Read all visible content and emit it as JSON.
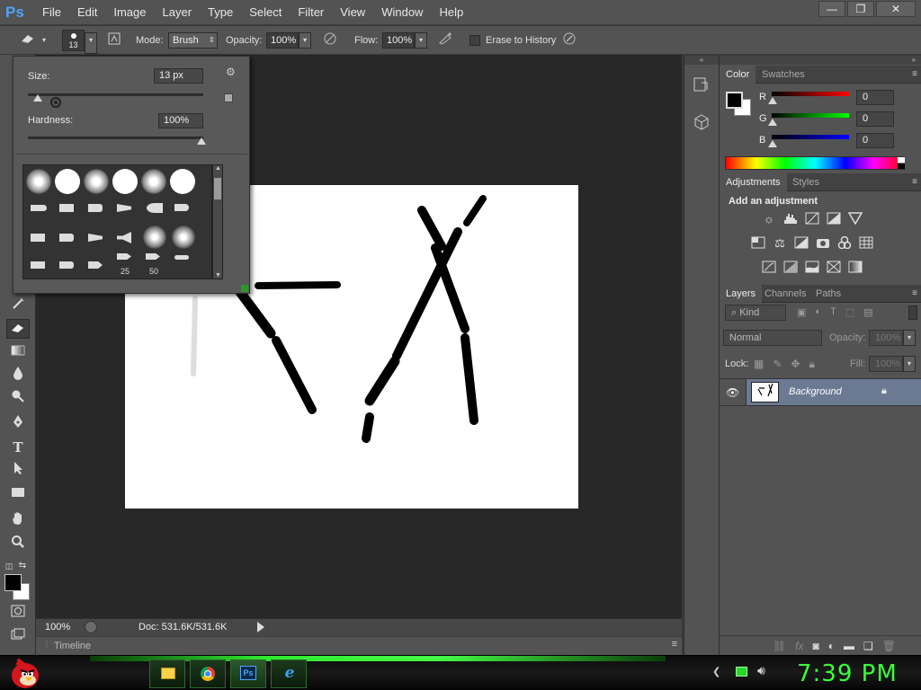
{
  "app": {
    "logo": "Ps",
    "menus": [
      "File",
      "Edit",
      "Image",
      "Layer",
      "Type",
      "Select",
      "Filter",
      "View",
      "Window",
      "Help"
    ]
  },
  "window_controls": {
    "minimize": "—",
    "restore": "❐",
    "close": "✕"
  },
  "options_bar": {
    "brush_size": "13",
    "mode_label": "Mode:",
    "mode_value": "Brush",
    "opacity_label": "Opacity:",
    "opacity_value": "100%",
    "flow_label": "Flow:",
    "flow_value": "100%",
    "erase_to_history_label": "Erase to History",
    "erase_to_history_checked": false
  },
  "brush_picker": {
    "size_label": "Size:",
    "size_value": "13 px",
    "size_level": 0.1,
    "hardness_label": "Hardness:",
    "hardness_value": "100%",
    "hardness_level": 1.0,
    "preset_labels": [
      "25",
      "50"
    ]
  },
  "status": {
    "zoom": "100%",
    "doc_info": "Doc: 531.6K/531.6K",
    "timeline_label": "Timeline"
  },
  "color_panel": {
    "tabs": [
      "Color",
      "Swatches"
    ],
    "channels": [
      {
        "label": "R",
        "value": "0",
        "color": "#ff0000"
      },
      {
        "label": "G",
        "value": "0",
        "color": "#00ff00"
      },
      {
        "label": "B",
        "value": "0",
        "color": "#0000ff"
      }
    ]
  },
  "adjustments_panel": {
    "tabs": [
      "Adjustments",
      "Styles"
    ],
    "heading": "Add an adjustment"
  },
  "layers_panel": {
    "tabs": [
      "Layers",
      "Channels",
      "Paths"
    ],
    "filter_kind": "Kind",
    "blend_mode": "Normal",
    "opacity_label": "Opacity:",
    "opacity_value": "100%",
    "lock_label": "Lock:",
    "fill_label": "Fill:",
    "fill_value": "100%",
    "layers": [
      {
        "name": "Background",
        "visible": true,
        "locked": true
      }
    ]
  },
  "taskbar": {
    "clock": "7:39 PM",
    "apps": [
      "file-explorer-icon",
      "chrome-icon",
      "photoshop-icon",
      "internet-explorer-icon"
    ],
    "ps_label": "Ps"
  },
  "colors": {
    "ui_dark": "#535353",
    "workspace": "#282828",
    "accent_green": "#39ff39"
  }
}
